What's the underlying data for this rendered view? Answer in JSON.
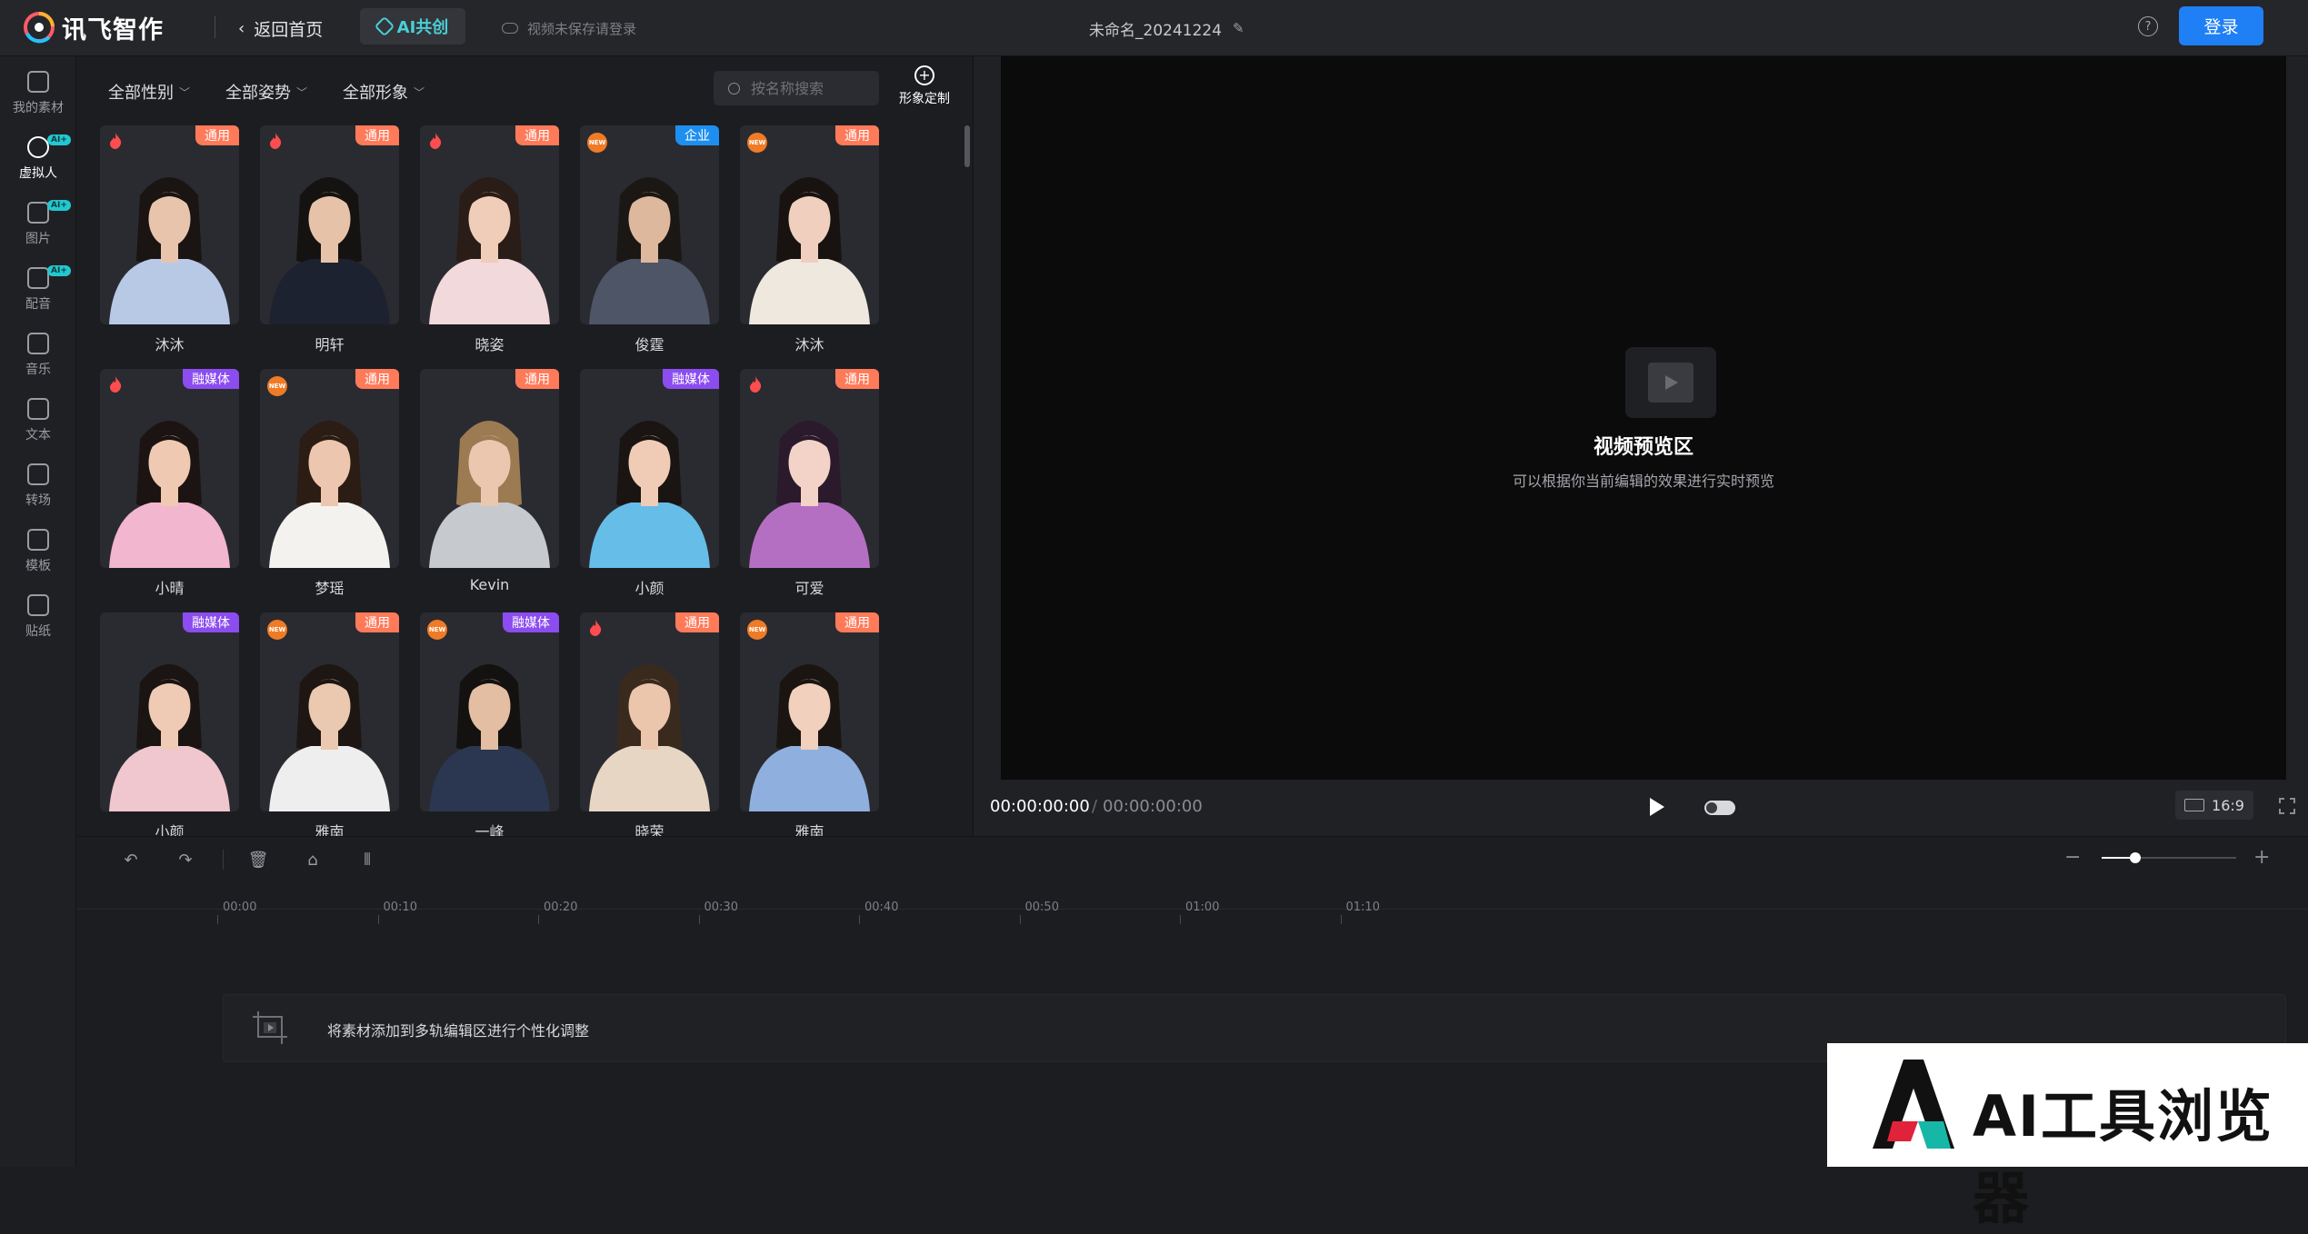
{
  "header": {
    "brand": "讯飞智作",
    "back_label": "返回首页",
    "ai_tab_label": "AI共创",
    "save_notice": "视频未保存请登录",
    "project_name": "未命名_20241224",
    "help_icon": "?",
    "login_label": "登录"
  },
  "rail": [
    {
      "label": "我的素材",
      "icon": "play-square-icon",
      "ai": false,
      "active": false
    },
    {
      "label": "虚拟人",
      "icon": "avatar-icon",
      "ai": true,
      "active": true
    },
    {
      "label": "图片",
      "icon": "image-icon",
      "ai": true,
      "active": false
    },
    {
      "label": "配音",
      "icon": "voice-icon",
      "ai": true,
      "active": false
    },
    {
      "label": "音乐",
      "icon": "music-icon",
      "ai": false,
      "active": false
    },
    {
      "label": "文本",
      "icon": "text-icon",
      "ai": false,
      "active": false
    },
    {
      "label": "转场",
      "icon": "transition-icon",
      "ai": false,
      "active": false
    },
    {
      "label": "模板",
      "icon": "template-icon",
      "ai": false,
      "active": false
    },
    {
      "label": "贴纸",
      "icon": "sticker-icon",
      "ai": false,
      "active": false
    }
  ],
  "ai_badge": "AI+",
  "filters": {
    "gender": "全部性别",
    "pose": "全部姿势",
    "image": "全部形象",
    "search_placeholder": "按名称搜索",
    "custom_label": "形象定制"
  },
  "avatars": [
    {
      "name": "沐沐",
      "tag": "通用",
      "badge": "hot",
      "skin": "#e8c4ad",
      "hair": "#1a1412",
      "outfit": "#b8c9e6"
    },
    {
      "name": "明轩",
      "tag": "通用",
      "badge": "hot",
      "skin": "#e6c3a8",
      "hair": "#151311",
      "outfit": "#1d2230"
    },
    {
      "name": "晓姿",
      "tag": "通用",
      "badge": "hot",
      "skin": "#f0cdb8",
      "hair": "#2a1c16",
      "outfit": "#f2d9dc"
    },
    {
      "name": "俊霆",
      "tag": "企业",
      "badge": "new",
      "skin": "#deb89c",
      "hair": "#1b1714",
      "outfit": "#4d5566"
    },
    {
      "name": "沐沐",
      "tag": "通用",
      "badge": "new",
      "skin": "#f0cfbe",
      "hair": "#181311",
      "outfit": "#efe8df"
    },
    {
      "name": "小晴",
      "tag": "融媒体",
      "badge": "hot",
      "skin": "#efc9b2",
      "hair": "#1c1412",
      "outfit": "#f2b6cf"
    },
    {
      "name": "梦瑶",
      "tag": "通用",
      "badge": "new",
      "skin": "#ecc6ae",
      "hair": "#2b1c14",
      "outfit": "#f4f2ee"
    },
    {
      "name": "Kevin",
      "tag": "通用",
      "badge": "none",
      "skin": "#eac7ae",
      "hair": "#9c7a52",
      "outfit": "#c6c9ce"
    },
    {
      "name": "小颜",
      "tag": "融媒体",
      "badge": "none",
      "skin": "#f0ccb6",
      "hair": "#1a1412",
      "outfit": "#66bde8"
    },
    {
      "name": "可爱",
      "tag": "通用",
      "badge": "hot",
      "skin": "#f3d3c8",
      "hair": "#2a1a2c",
      "outfit": "#b56fc2"
    },
    {
      "name": "小颜",
      "tag": "融媒体",
      "badge": "none",
      "skin": "#efcab4",
      "hair": "#1a1412",
      "outfit": "#f0c7cf"
    },
    {
      "name": "雅南",
      "tag": "通用",
      "badge": "new",
      "skin": "#ebc8b0",
      "hair": "#1d1612",
      "outfit": "#eeeeee"
    },
    {
      "name": "一峰",
      "tag": "融媒体",
      "badge": "new",
      "skin": "#e3bea2",
      "hair": "#141210",
      "outfit": "#2b3650"
    },
    {
      "name": "晓荣",
      "tag": "通用",
      "badge": "hot",
      "skin": "#ebc6ad",
      "hair": "#3a2a1e",
      "outfit": "#e8d6c4"
    },
    {
      "name": "雅南",
      "tag": "通用",
      "badge": "new",
      "skin": "#f1d0bd",
      "hair": "#1b1512",
      "outfit": "#8fb0de"
    }
  ],
  "tag_colors": {
    "通用": "#ff7a59",
    "企业": "#1e8ff0",
    "融媒体": "#8b4cf0"
  },
  "new_badge": "NEW",
  "preview": {
    "title": "视频预览区",
    "subtitle": "可以根据你当前编辑的效果进行实时预览",
    "time_current": "00:00:00:00",
    "time_separator": "/",
    "time_total": "00:00:00:00",
    "ratio": "16:9"
  },
  "timeline": {
    "ticks": [
      "00:00",
      "00:10",
      "00:20",
      "00:30",
      "00:40",
      "00:50",
      "01:00",
      "01:10"
    ],
    "zoom_minus": "−",
    "zoom_plus": "+",
    "zoom_level": 0.25,
    "drop_hint": "将素材添加到多轨编辑区进行个性化调整"
  },
  "watermark": {
    "text": "AI工具浏览器"
  }
}
